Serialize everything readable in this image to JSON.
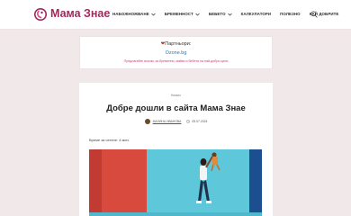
{
  "header": {
    "logo_text": "Мама Знае",
    "nav": [
      {
        "label": "НАБОЖНОЖВАНЕ",
        "has_dropdown": true
      },
      {
        "label": "БРЕМЕННОСТ",
        "has_dropdown": true
      },
      {
        "label": "БЕБЕТО",
        "has_dropdown": true
      },
      {
        "label": "КАЛКУЛАТОРИ",
        "has_dropdown": false
      },
      {
        "label": "ПОЛЕЗНО",
        "has_dropdown": false
      },
      {
        "label": "КАЙ ДОБРИТЕ",
        "has_dropdown": false
      }
    ]
  },
  "partners": {
    "title": "Партньори:",
    "link": "Ozone.bg",
    "note": "Предлагайте всичко за бременни, майки и бебета на най-добри цени"
  },
  "article": {
    "category": "Начало",
    "title": "Добре дошли в сайта Мама Знае",
    "author": "МАЛИНА ИВАНОВА",
    "date": "05.07.2024",
    "reading_time": "Време за четене: 4 мин."
  },
  "colors": {
    "brand": "#9e2a5c",
    "background": "#f1e8ea",
    "link": "#1a7bc4",
    "note": "#d63a67"
  }
}
